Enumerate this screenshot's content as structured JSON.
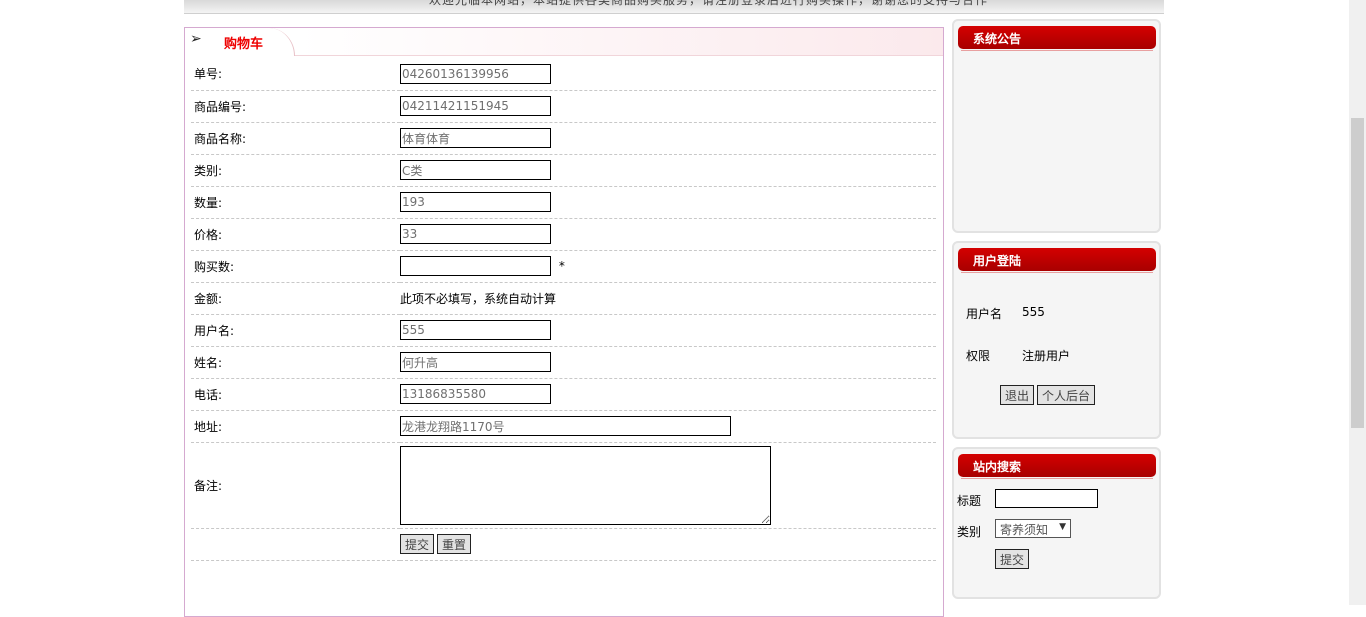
{
  "top_banner": {
    "scroll_text": "欢迎光临本网站，本站提供各类商品购买服务，请注册登录后进行购买操作，谢谢您的支持与合作"
  },
  "cart": {
    "title": "购物车",
    "fields": [
      {
        "key": "order_no",
        "label": "单号:",
        "value": "04260136139956"
      },
      {
        "key": "product_no",
        "label": "商品编号:",
        "value": "04211421151945"
      },
      {
        "key": "product_name",
        "label": "商品名称:",
        "value": "体育体育"
      },
      {
        "key": "category",
        "label": "类别:",
        "value": "C类"
      },
      {
        "key": "quantity",
        "label": "数量:",
        "value": "193"
      },
      {
        "key": "price",
        "label": "价格:",
        "value": "33"
      },
      {
        "key": "buy_count",
        "label": "购买数:",
        "value": "",
        "required_mark": "*"
      },
      {
        "key": "amount",
        "label": "金额:",
        "note": "此项不必填写，系统自动计算"
      },
      {
        "key": "username",
        "label": "用户名:",
        "value": "555"
      },
      {
        "key": "name",
        "label": "姓名:",
        "value": "何升高"
      },
      {
        "key": "phone",
        "label": "电话:",
        "value": "13186835580"
      },
      {
        "key": "address",
        "label": "地址:",
        "value": "龙港龙翔路1170号"
      },
      {
        "key": "remark",
        "label": "备注:",
        "value": ""
      }
    ],
    "submit_label": "提交",
    "reset_label": "重置"
  },
  "announcement": {
    "title": "系统公告"
  },
  "login": {
    "title": "用户登陆",
    "username_label": "用户名",
    "username_value": "555",
    "role_label": "权限",
    "role_value": "注册用户",
    "logout_label": "退出",
    "backend_label": "个人后台"
  },
  "search": {
    "title": "站内搜索",
    "title_label": "标题",
    "title_value": "",
    "category_label": "类别",
    "category_selected": "寄养须知",
    "submit_label": "提交"
  },
  "icons": {
    "header_arrow": "arrow-right-icon",
    "select_caret": "triangle-down-icon"
  },
  "colors": {
    "accent_red": "#e00000",
    "side_header": "#c00000",
    "panel_border": "#d5a9d0"
  }
}
